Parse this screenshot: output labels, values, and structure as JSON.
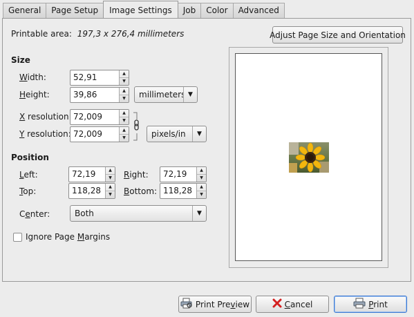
{
  "tabs": [
    {
      "label": "General"
    },
    {
      "label": "Page Setup"
    },
    {
      "label": "Image Settings"
    },
    {
      "label": "Job"
    },
    {
      "label": "Color"
    },
    {
      "label": "Advanced"
    }
  ],
  "active_tab": "Image Settings",
  "printable_area": {
    "label": "Printable area:",
    "value": "197,3 x 276,4 millimeters"
  },
  "adjust_button": {
    "label": "Adjust Page Size and Orientation"
  },
  "size": {
    "heading": "Size",
    "width": {
      "label_u": "W",
      "label_rest": "idth:",
      "value": "52,91"
    },
    "height": {
      "label_u": "H",
      "label_rest": "eight:",
      "value": "39,86"
    },
    "unit": "millimeters",
    "x_resolution": {
      "label_u": "X",
      "label_rest": " resolution:",
      "value": "72,009"
    },
    "y_resolution": {
      "label_u": "Y",
      "label_rest": " resolution:",
      "value": "72,009"
    },
    "resolution_unit": "pixels/in"
  },
  "position": {
    "heading": "Position",
    "left": {
      "label_u": "L",
      "label_rest": "eft:",
      "value": "72,19"
    },
    "right": {
      "label_u": "R",
      "label_rest": "ight:",
      "value": "72,19"
    },
    "top": {
      "label_u": "T",
      "label_rest": "op:",
      "value": "118,28"
    },
    "bottom": {
      "label_u": "B",
      "label_rest": "ottom:",
      "value": "118,28"
    },
    "center": {
      "label_pre": "C",
      "label_u": "e",
      "label_rest": "nter:",
      "value": "Both"
    }
  },
  "ignore_margins": {
    "label_pre": "Ignore Page ",
    "label_u": "M",
    "label_rest": "argins",
    "checked": false
  },
  "buttons": {
    "print_preview": {
      "label_pre": "Print Pre",
      "label_u": "v",
      "label_rest": "iew",
      "icon": "print-preview-icon"
    },
    "cancel": {
      "label_pre": "",
      "label_u": "C",
      "label_rest": "ancel",
      "icon": "cancel-icon"
    },
    "print": {
      "label_pre": "",
      "label_u": "P",
      "label_rest": "rint",
      "icon": "printer-icon"
    }
  },
  "preview": {
    "image": "sunflower thumbnail"
  },
  "colors": {
    "default_button_border": "#3f7ad1",
    "cancel_icon": "#d42020"
  }
}
